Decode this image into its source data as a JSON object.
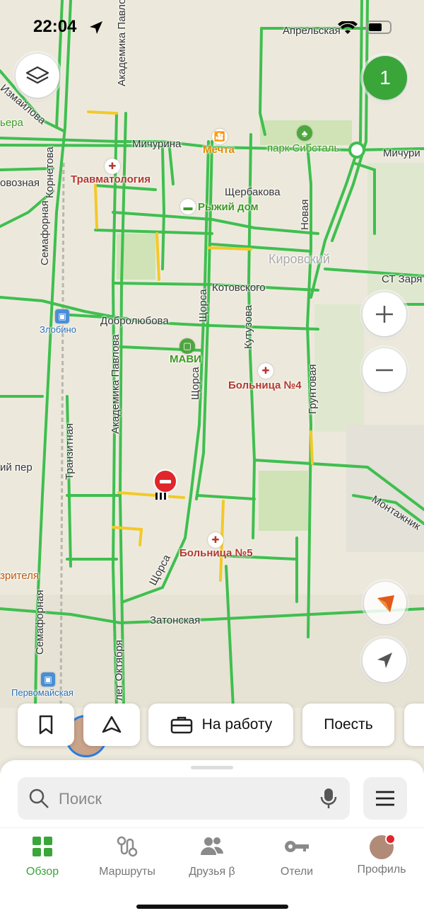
{
  "status_bar": {
    "time": "22:04"
  },
  "traffic_badge": "1",
  "map": {
    "streets": {
      "mich1": "Мичурина",
      "mich2": "Мичури",
      "april": "Апрельская",
      "izm": "Измайлова",
      "bera": "ьера",
      "vozn": "овозная",
      "kornet": "Корнетова",
      "semafor": "Семафорная",
      "semafor2": "Семафорная",
      "scherb": "Щербакова",
      "novaya": "Новая",
      "kirov": "Кировский",
      "zarya": "СТ Заря",
      "kotov": "Котовского",
      "dobro": "Добролюбова",
      "schors1": "Щорса",
      "schors2": "Щорса",
      "schors3": "Щорса",
      "kutuz": "Кутузова",
      "grunt": "Грунтовая",
      "pavlova": "Академика Павлова",
      "pavlova_top": "Академика Павлова",
      "tranz": "Транзитная",
      "yper": "ий пер",
      "montaj": "Монтажник",
      "zriv": "зрителя",
      "zaton": "Затонская",
      "oktyabr": "лет Октября",
      "zlobino": "Злобино",
      "pervomai": "Первомайская"
    },
    "pois": {
      "mechta": "Мечта",
      "park": "парк Сибсталь",
      "travma": "Травматология",
      "ryzhy": "Рыжий дом",
      "mavi": "МАВИ",
      "bol4": "Больница №4",
      "bol5": "Больница №5"
    }
  },
  "chips": {
    "work": "На работу",
    "eat": "Поесть"
  },
  "search": {
    "placeholder": "Поиск"
  },
  "tabs": [
    {
      "label": "Обзор",
      "active": true
    },
    {
      "label": "Маршруты"
    },
    {
      "label": "Друзья β"
    },
    {
      "label": "Отели"
    },
    {
      "label": "Профиль"
    }
  ],
  "colors": {
    "accent": "#3aa63a",
    "road_green": "#3fbf4f",
    "road_yellow": "#f3c928",
    "poi_red": "#b3382f",
    "poi_green": "#3d9a22",
    "poi_orange": "#e08a00"
  }
}
